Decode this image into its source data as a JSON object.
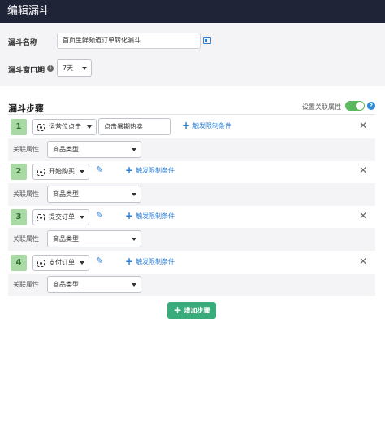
{
  "header": {
    "title": "编辑漏斗"
  },
  "form": {
    "name_label": "漏斗名称",
    "name_value": "首页生鲜频道订单转化漏斗",
    "window_label": "漏斗窗口期",
    "window_value": "7天"
  },
  "steps_section": {
    "title": "漏斗步骤",
    "assoc_toggle_label": "设置关联属性",
    "assoc_toggle_on": true,
    "help_glyph": "?"
  },
  "steps": [
    {
      "number": "1",
      "event": "运营位点击",
      "filter_value": "点击暑期热卖",
      "add_condition": "触发限制条件",
      "attr_label": "关联属性",
      "attr_value": "商品类型"
    },
    {
      "number": "2",
      "event": "开始购买",
      "add_condition": "触发限制条件",
      "attr_label": "关联属性",
      "attr_value": "商品类型"
    },
    {
      "number": "3",
      "event": "提交订单",
      "add_condition": "触发限制条件",
      "attr_label": "关联属性",
      "attr_value": "商品类型"
    },
    {
      "number": "4",
      "event": "支付订单",
      "add_condition": "触发限制条件",
      "attr_label": "关联属性",
      "attr_value": "商品类型"
    }
  ],
  "add_step_label": "增加步骤",
  "colors": {
    "header_bg": "#1f2437",
    "accent_blue": "#2c7fd6",
    "badge_green": "#a9d9a4",
    "button_green": "#3aab7a"
  },
  "icons": [
    "info-icon",
    "card-icon",
    "event-target-icon",
    "pencil-icon",
    "plus-icon",
    "close-icon",
    "question-icon"
  ]
}
